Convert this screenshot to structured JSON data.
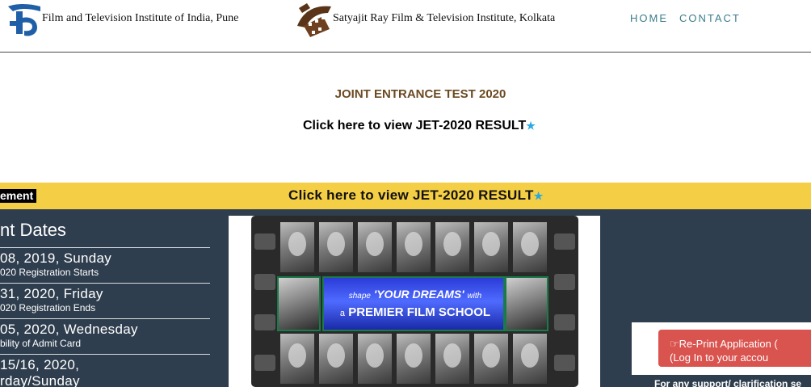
{
  "header": {
    "institute_1": "Film and Television Institute of India, Pune",
    "institute_2": "Satyajit Ray Film & Television Institute, Kolkata",
    "nav": {
      "home": "HOME",
      "contact": "CONTACT"
    }
  },
  "intro": {
    "title": "JOINT ENTRANCE TEST 2020",
    "result_link": "Click here to view JET-2020 RESULT"
  },
  "announcement": {
    "tag": "ement",
    "link": "Click here to view JET-2020 RESULT"
  },
  "important_dates": {
    "title": "nt Dates",
    "items": [
      {
        "date": " 08, 2019, Sunday",
        "event": "020 Registration Starts"
      },
      {
        "date": "31, 2020, Friday",
        "event": "020 Registration Ends"
      },
      {
        "date": "05, 2020, Wednesday",
        "event": "bility of Admit Card"
      },
      {
        "date": "15/16, 2020,",
        "event": "rday/Sunday"
      }
    ]
  },
  "banner": {
    "line1_small": "shape",
    "line1_big": "'YOUR DREAMS'",
    "line1_tail": "with",
    "line2_small": "a",
    "line2_big": "PREMIER FILM SCHOOL"
  },
  "right_panel": {
    "reprint_line1": "Re-Print Application (",
    "reprint_line2": "(Log In to your accou",
    "support": "For any support/ clarification se"
  },
  "colors": {
    "nav": "#3a7d8c",
    "title_brown": "#6b4a22",
    "announcement_bg": "#f4ce45",
    "dark_panel": "#2f3e4e",
    "reprint_button": "#d9534f",
    "star": "#29a9e1"
  },
  "icons": [
    "ftii-logo-icon",
    "srfti-logo-icon",
    "star-icon",
    "hand-pointer-icon"
  ]
}
